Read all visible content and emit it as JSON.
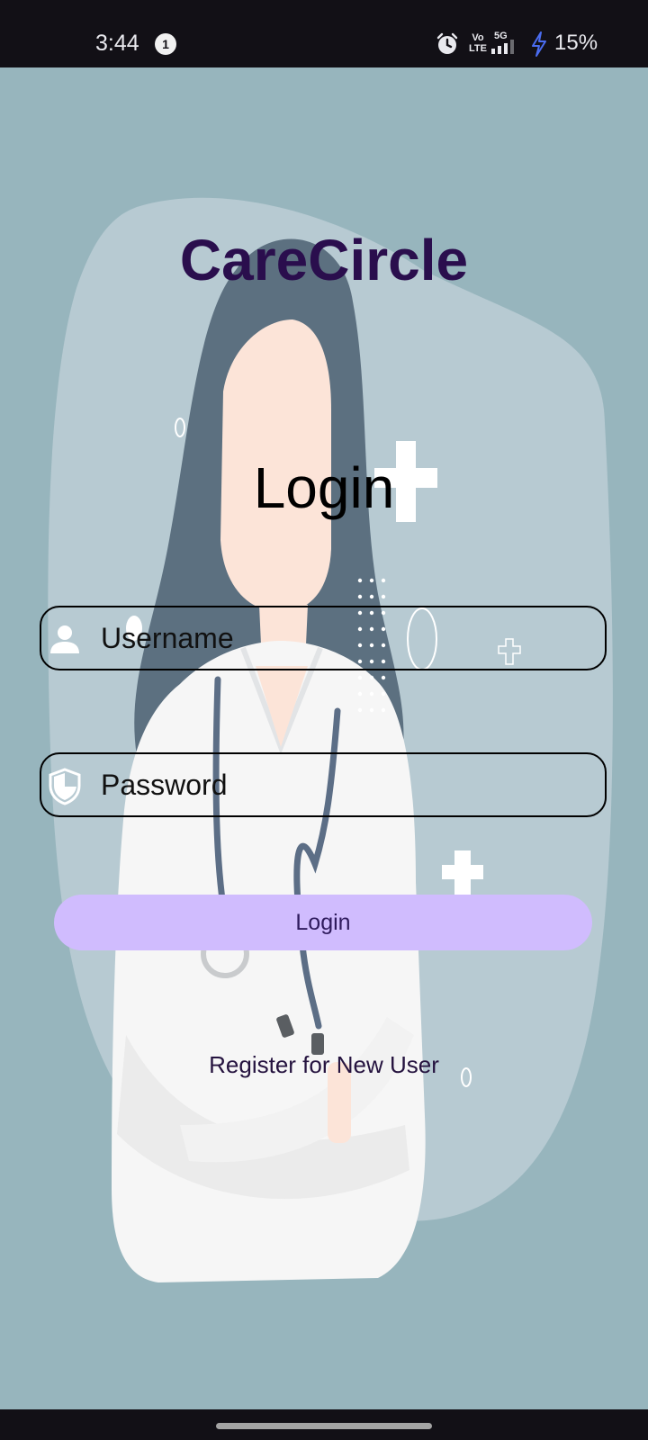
{
  "status_bar": {
    "time": "3:44",
    "notification_count": "1",
    "network_label_top": "Vo",
    "network_label_bottom": "LTE",
    "network_type": "5G",
    "battery": "15%"
  },
  "app": {
    "title": "CareCircle",
    "heading": "Login"
  },
  "form": {
    "username_placeholder": "Username",
    "password_placeholder": "Password",
    "login_button": "Login",
    "register_link": "Register for New User"
  },
  "colors": {
    "background": "#97b5bd",
    "blob": "#b7cad2",
    "title": "#2a0e4d",
    "button": "#d0bcfe",
    "button_text": "#2f1b5d"
  },
  "icons": {
    "username": "person-icon",
    "password": "shield-icon",
    "alarm": "alarm-icon",
    "signal": "signal-icon",
    "charging": "charging-icon"
  }
}
